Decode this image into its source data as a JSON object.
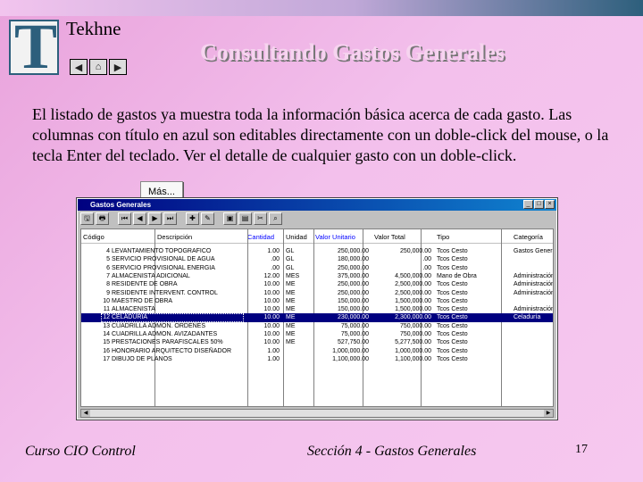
{
  "header": {
    "logo_letter": "T",
    "logo_name": "Tekhne",
    "nav_buttons": [
      {
        "icon": "previous-triangle-icon",
        "glyph": "◀"
      },
      {
        "icon": "home-icon",
        "glyph": "⌂"
      },
      {
        "icon": "next-triangle-icon",
        "glyph": "▶"
      }
    ]
  },
  "title": "Consultando Gastos Generales",
  "body_text": "El listado de gastos ya muestra toda la información básica acerca de cada gasto. Las columnas con título en azul son editables directamente con un doble-click del mouse, o la tecla Enter del teclado. Ver el detalle de cualquier gasto con un doble-click.",
  "more_button": "Más...",
  "window": {
    "title": "Gastos Generales",
    "controls": [
      "_",
      "□",
      "×"
    ],
    "toolbar": [
      "🖫",
      "🖶",
      "⏮",
      "◀",
      "▶",
      "⏭",
      "✚",
      "✎",
      "▣",
      "▤",
      "✂",
      "⌕"
    ],
    "columns": [
      {
        "label": "Código",
        "editable": false
      },
      {
        "label": "Descripción",
        "editable": false
      },
      {
        "label": "Cantidad",
        "editable": true
      },
      {
        "label": "Unidad",
        "editable": false
      },
      {
        "label": "Valor Unitario",
        "editable": true
      },
      {
        "label": "Valor Total",
        "editable": false
      },
      {
        "label": "Tipo",
        "editable": false
      },
      {
        "label": "Categoría",
        "editable": false
      }
    ],
    "rows": [
      [
        "4",
        "LEVANTAMIENTO TOPOGRAFICO",
        "1.00",
        "GL",
        "250,000.00",
        "250,000.00",
        "Tcos Cesto",
        "Gastos Generales"
      ],
      [
        "5",
        "SERVICIO PROVISIONAL DE AGUA",
        ".00",
        "GL",
        "180,000.00",
        ".00",
        "Tcos Cesto",
        ""
      ],
      [
        "6",
        "SERVICIO PROVISIONAL ENERGIA",
        ".00",
        "GL",
        "250,000.00",
        ".00",
        "Tcos Cesto",
        ""
      ],
      [
        "7",
        "ALMACENISTA ADICIONAL",
        "12.00",
        "MES",
        "375,000.00",
        "4,500,000.00",
        "Mano de Obra",
        "Administración"
      ],
      [
        "8",
        "RESIDENTE DE OBRA",
        "10.00",
        "ME",
        "250,000.00",
        "2,500,000.00",
        "Tcos Cesto",
        "Administración"
      ],
      [
        "9",
        "RESIDENTE INTERVENT. CONTROL",
        "10.00",
        "ME",
        "250,000.00",
        "2,500,000.00",
        "Tcos Cesto",
        "Administración"
      ],
      [
        "10",
        "MAESTRO DE OBRA",
        "10.00",
        "ME",
        "150,000.00",
        "1,500,000.00",
        "Tcos Cesto",
        ""
      ],
      [
        "11",
        "ALMACENISTA",
        "10.00",
        "ME",
        "150,000.00",
        "1,500,000.00",
        "Tcos Cesto",
        "Administración"
      ],
      [
        "12",
        "CELADURIA",
        "10.00",
        "ME",
        "230,000.00",
        "2,300,000.00",
        "Tcos Cesto",
        "Celaduría"
      ],
      [
        "13",
        "CUADRILLA ADMON. ORDENES",
        "10.00",
        "ME",
        "75,000.00",
        "750,000.00",
        "Tcos Cesto",
        ""
      ],
      [
        "14",
        "CUADRILLA ADMON. AVIZADANTES",
        "10.00",
        "ME",
        "75,000.00",
        "750,000.00",
        "Tcos Cesto",
        ""
      ],
      [
        "15",
        "PRESTACIONES PARAFISCALES 50%",
        "10.00",
        "ME",
        "527,750.00",
        "5,277,500.00",
        "Tcos Cesto",
        ""
      ],
      [
        "16",
        "HONORARIO ARQUITECTO DISEÑADOR",
        "1.00",
        "",
        "1,000,000.00",
        "1,000,000.00",
        "Tcos Cesto",
        ""
      ],
      [
        "17",
        "DIBUJO DE PLANOS",
        "1.00",
        "",
        "1,100,000.00",
        "1,100,000.00",
        "Tcos Cesto",
        ""
      ]
    ],
    "selected_row_index": 8
  },
  "footer": {
    "left": "Curso CIO Control",
    "center": "Sección 4 - Gastos Generales",
    "page": "17"
  }
}
